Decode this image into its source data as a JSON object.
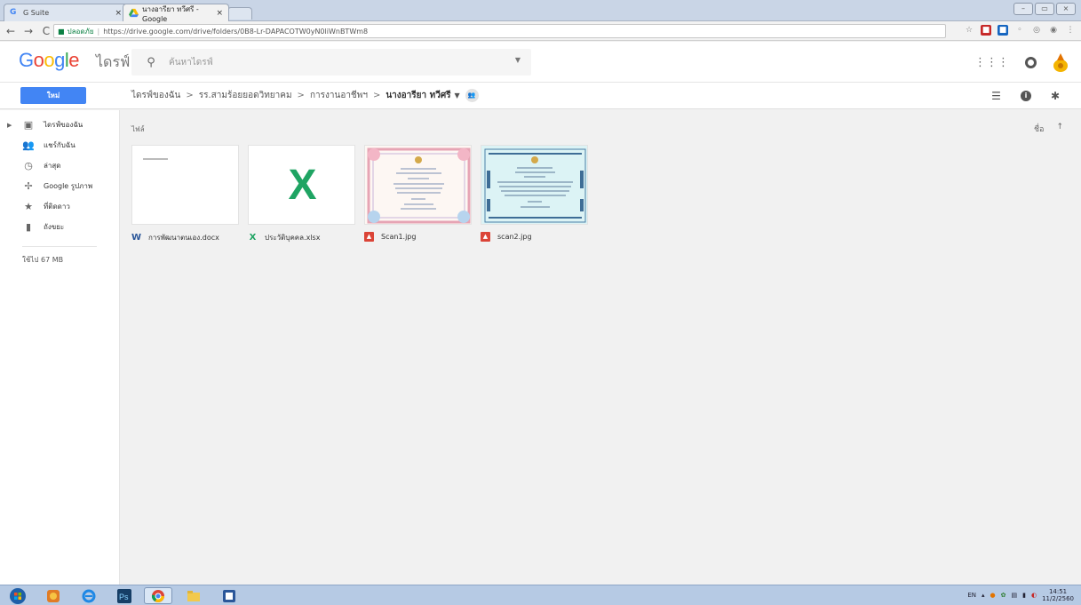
{
  "browser": {
    "tabs": [
      {
        "label": "G Suite"
      },
      {
        "label": "นางอารียา ทวีศรี - Google"
      }
    ],
    "close_glyph": "×",
    "window_controls": [
      "–",
      "▭",
      "×"
    ],
    "url_secure_label": "ปลอดภัย",
    "url": "https://drive.google.com/drive/folders/0B8-Lr-DAPACOTW0yN0liWnBTWm8"
  },
  "header": {
    "logo": "Google",
    "product": "ไดรฟ์",
    "search_placeholder": "ค้นหาไดรฟ์"
  },
  "toolbar": {
    "new_label": "ใหม่",
    "breadcrumb": [
      "ไดรฟ์ของฉัน",
      "รร.สามร้อยยอดวิทยาคม",
      "การงานอาชีพฯ"
    ],
    "current_folder": "นางอารียา ทวีศรี",
    "crumb_sep": ">"
  },
  "sidebar": {
    "items": [
      {
        "label": "ไดรฟ์ของฉัน",
        "icon": "drive-icon"
      },
      {
        "label": "แชร์กับฉัน",
        "icon": "shared-icon"
      },
      {
        "label": "ล่าสุด",
        "icon": "clock-icon"
      },
      {
        "label": "Google รูปภาพ",
        "icon": "photos-icon"
      },
      {
        "label": "ที่ติดดาว",
        "icon": "star-icon"
      },
      {
        "label": "ถังขยะ",
        "icon": "trash-icon"
      }
    ],
    "storage": "ใช้ไป 67 MB"
  },
  "main": {
    "section_title": "ไฟล์",
    "sort_label": "ชื่อ",
    "sort_arrow": "↑",
    "files": [
      {
        "name": "การพัฒนาตนเอง.docx",
        "type": "word",
        "type_glyph": "W"
      },
      {
        "name": "ประวัติบุคคล.xlsx",
        "type": "excel",
        "type_glyph": "X"
      },
      {
        "name": "Scan1.jpg",
        "type": "image"
      },
      {
        "name": "scan2.jpg",
        "type": "image"
      }
    ],
    "xlsx_thumb_glyph": "X"
  },
  "taskbar": {
    "lang": "EN",
    "time": "14:51",
    "date": "11/2/2560"
  },
  "colors": {
    "accent": "#4285f4",
    "excel": "#1fa463",
    "word": "#2a5699",
    "image": "#db4437"
  }
}
